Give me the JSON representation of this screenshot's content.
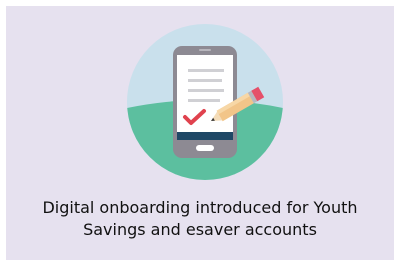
{
  "colors": {
    "card_background": "#e6e1ef",
    "circle_sky": "#c9e0ec",
    "circle_hill": "#5cbf9f",
    "phone_body": "#8d8a93",
    "phone_screen": "#ffffff",
    "phone_bar": "#1f4866",
    "check_mark": "#e0424e",
    "pencil_body": "#f2c589",
    "pencil_eraser": "#e5506a",
    "text": "#111111"
  },
  "illustration": {
    "icon": "phone-with-checklist-and-pencil-icon"
  },
  "caption": {
    "line1": "Digital onboarding introduced for Youth",
    "line2": "Savings and esaver accounts"
  }
}
